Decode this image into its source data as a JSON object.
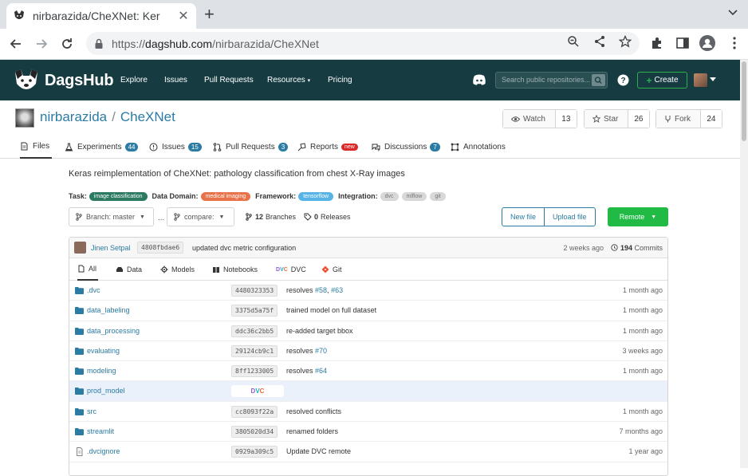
{
  "browser": {
    "tab_title": "nirbarazida/CheXNet: Ker",
    "url_host": "dagshub.com",
    "url_prefix": "https://",
    "url_path": "/nirbarazida/CheXNet"
  },
  "header": {
    "logo": "DagsHub",
    "nav": [
      "Explore",
      "Issues",
      "Pull Requests",
      "Resources",
      "Pricing"
    ],
    "search_placeholder": "Search public repositories...",
    "create_label": "Create"
  },
  "repo": {
    "owner": "nirbarazida",
    "name": "CheXNet",
    "watch_label": "Watch",
    "watch_count": "13",
    "star_label": "Star",
    "star_count": "26",
    "fork_label": "Fork",
    "fork_count": "24"
  },
  "tabs": [
    {
      "label": "Files"
    },
    {
      "label": "Experiments",
      "count": "44"
    },
    {
      "label": "Issues",
      "count": "15"
    },
    {
      "label": "Pull Requests",
      "count": "3"
    },
    {
      "label": "Reports",
      "count": "new"
    },
    {
      "label": "Discussions",
      "count": "7"
    },
    {
      "label": "Annotations"
    }
  ],
  "description": "Keras reimplementation of CheXNet: pathology classification from chest X-Ray images",
  "tags": {
    "task_label": "Task:",
    "task": "image classification",
    "domain_label": "Data Domain:",
    "domain": "medical imaging",
    "framework_label": "Framework:",
    "framework": "tensorflow",
    "integration_label": "Integration:",
    "integrations": [
      "dvc",
      "mlflow",
      "git"
    ]
  },
  "controls": {
    "branch": "Branch: master",
    "compare": "compare:",
    "dots": "...",
    "branches_count": "12",
    "branches_label": "Branches",
    "releases_count": "0",
    "releases_label": "Releases",
    "new_file": "New file",
    "upload_file": "Upload file",
    "remote": "Remote"
  },
  "commit": {
    "author": "Jinen Setpal",
    "sha": "4808fbdae6",
    "message": "updated dvc metric configuration",
    "when": "2 weeks ago",
    "commits_count": "194",
    "commits_label": "Commits"
  },
  "file_tabs": [
    "All",
    "Data",
    "Models",
    "Notebooks",
    "DVC",
    "Git"
  ],
  "files": [
    {
      "name": ".dvc",
      "sha": "4480323353",
      "msg": "resolves ",
      "refs": [
        "#58",
        "#63"
      ],
      "when": "1 month ago",
      "type": "folder"
    },
    {
      "name": "data_labeling",
      "sha": "3375d5a75f",
      "msg": "trained model on full dataset",
      "when": "1 month ago",
      "type": "folder"
    },
    {
      "name": "data_processing",
      "sha": "ddc36c2bb5",
      "msg": "re-added target bbox",
      "when": "1 month ago",
      "type": "folder"
    },
    {
      "name": "evaluating",
      "sha": "29124cb9c1",
      "msg": "resolves ",
      "refs": [
        "#70"
      ],
      "when": "3 weeks ago",
      "type": "folder"
    },
    {
      "name": "modeling",
      "sha": "8ff1233005",
      "msg": "resolves ",
      "refs": [
        "#64"
      ],
      "when": "1 month ago",
      "type": "folder"
    },
    {
      "name": "prod_model",
      "sha": "",
      "msg": "",
      "when": "",
      "type": "dvc-folder"
    },
    {
      "name": "src",
      "sha": "cc8093f22a",
      "msg": "resolved conflicts",
      "when": "1 month ago",
      "type": "folder"
    },
    {
      "name": "streamlit",
      "sha": "3805020d34",
      "msg": "renamed folders",
      "when": "7 months ago",
      "type": "folder"
    },
    {
      "name": ".dvcignore",
      "sha": "0929a309c5",
      "msg": "Update DVC remote",
      "when": "1 year ago",
      "type": "file"
    }
  ],
  "colors": {
    "header_bg": "#163b40",
    "link": "#2b7ba3",
    "green": "#21ba45"
  }
}
